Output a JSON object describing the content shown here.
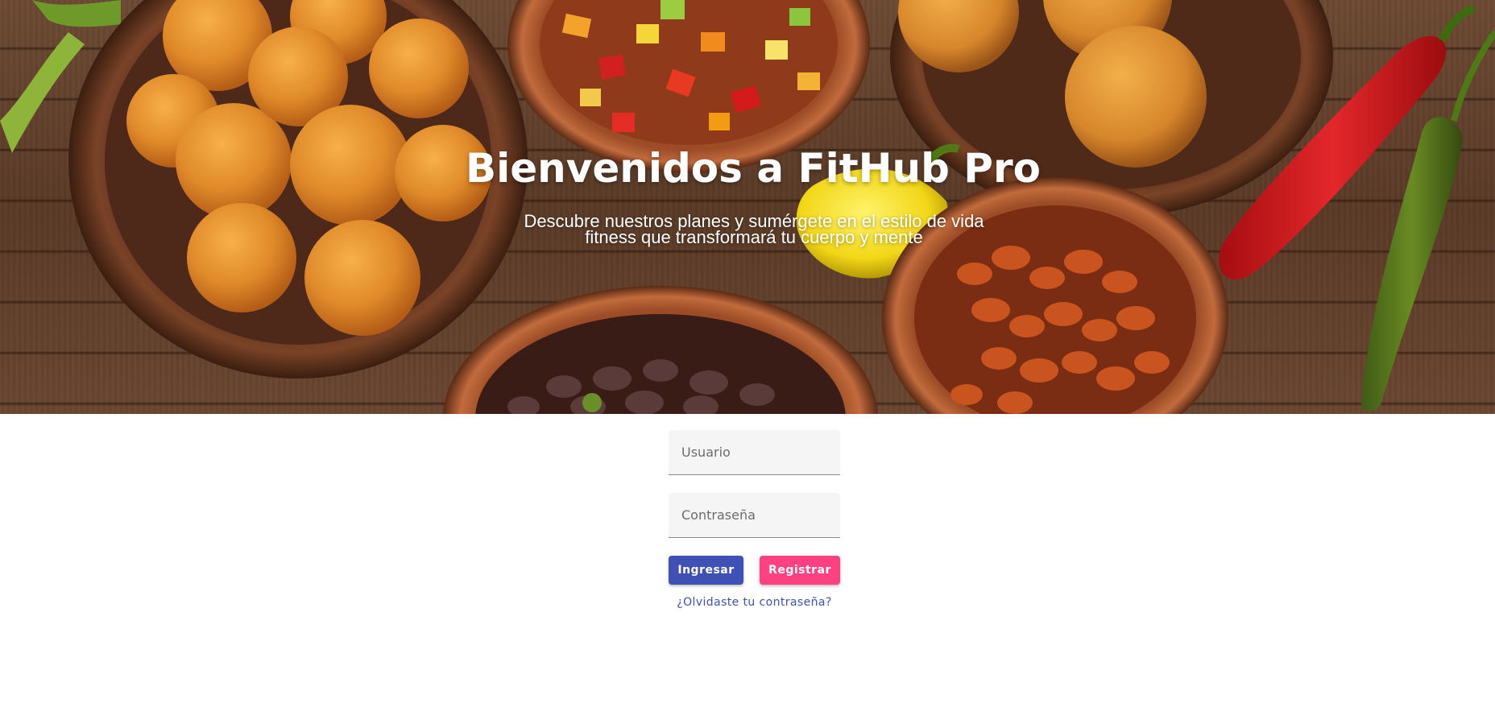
{
  "hero": {
    "title": "Bienvenidos a FitHub Pro",
    "subtitle": "Descubre nuestros planes y sumérgete en el estilo de vida fitness que transformará tu cuerpo y mente"
  },
  "login": {
    "username_placeholder": "Usuario",
    "username_value": "",
    "password_placeholder": "Contraseña",
    "password_value": "",
    "login_label": "Ingresar",
    "register_label": "Registrar",
    "forgot_label": "¿Olvidaste tu contraseña?"
  },
  "colors": {
    "primary": "#3f51b5",
    "accent": "#ff4081",
    "field_background": "#f5f5f5"
  }
}
